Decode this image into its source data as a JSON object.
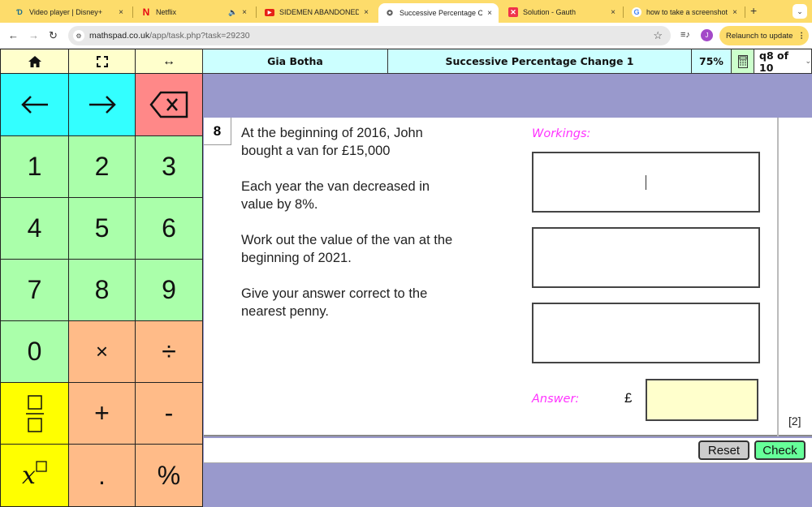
{
  "browser": {
    "tabs": [
      {
        "title": "Video player | Disney+",
        "favicon": "disney-plus-icon",
        "active": false
      },
      {
        "title": "Netflix",
        "favicon": "netflix-icon",
        "active": false,
        "audio": true
      },
      {
        "title": "SIDEMEN ABANDONED IN",
        "favicon": "youtube-icon",
        "active": false
      },
      {
        "title": "Successive Percentage Ch",
        "favicon": "mathspad-icon",
        "active": true
      },
      {
        "title": "Solution - Gauth",
        "favicon": "gauth-icon",
        "active": false
      },
      {
        "title": "how to take a screenshot",
        "favicon": "google-icon",
        "active": false
      }
    ],
    "close_glyph": "×",
    "newtab_glyph": "+",
    "url_domain": "mathspad.co.uk",
    "url_path": "/app/task.php?task=29230",
    "avatar_letter": "J",
    "relaunch_label": "Relaunch to update"
  },
  "keypad": {
    "top_row": [
      "home",
      "fullscreen",
      "resize"
    ],
    "top_icons": [
      "⌂",
      "⛶",
      "↔"
    ],
    "nav": {
      "left": "←",
      "right": "→",
      "backspace": "⌫"
    },
    "digits": [
      "1",
      "2",
      "3",
      "4",
      "5",
      "6",
      "7",
      "8",
      "9",
      "0"
    ],
    "ops": {
      "multiply": "×",
      "divide": "÷",
      "plus": "+",
      "minus": "-",
      "point": ".",
      "percent": "%"
    },
    "power_base": "x"
  },
  "header": {
    "student_name": "Gia Botha",
    "task_title": "Successive Percentage Change 1",
    "score": "75%",
    "question_selector": "q8 of 10"
  },
  "question": {
    "number": "8",
    "paragraphs": [
      "At the beginning of 2016, John bought a van for £15,000",
      "Each year the van decreased in value by 8%.",
      "Work out the value of the van at the beginning of 2021.",
      "Give your answer correct to the nearest penny."
    ],
    "workings_label": "Workings:",
    "answer_label": "Answer:",
    "currency": "£",
    "answer_value": "",
    "marks": "[2]"
  },
  "actions": {
    "reset_label": "Reset",
    "check_label": "Check"
  },
  "colors": {
    "background": "#9999cc",
    "header": "#ccffff",
    "keypad_nav": "#33ffff",
    "keypad_backspace": "#ff8888",
    "keypad_digits": "#aaffaa",
    "keypad_ops": "#ffbb88",
    "keypad_special": "#ffff00",
    "label_pink": "#ff33ff",
    "answer_box": "#ffffcc",
    "check_button": "#66ff99"
  }
}
